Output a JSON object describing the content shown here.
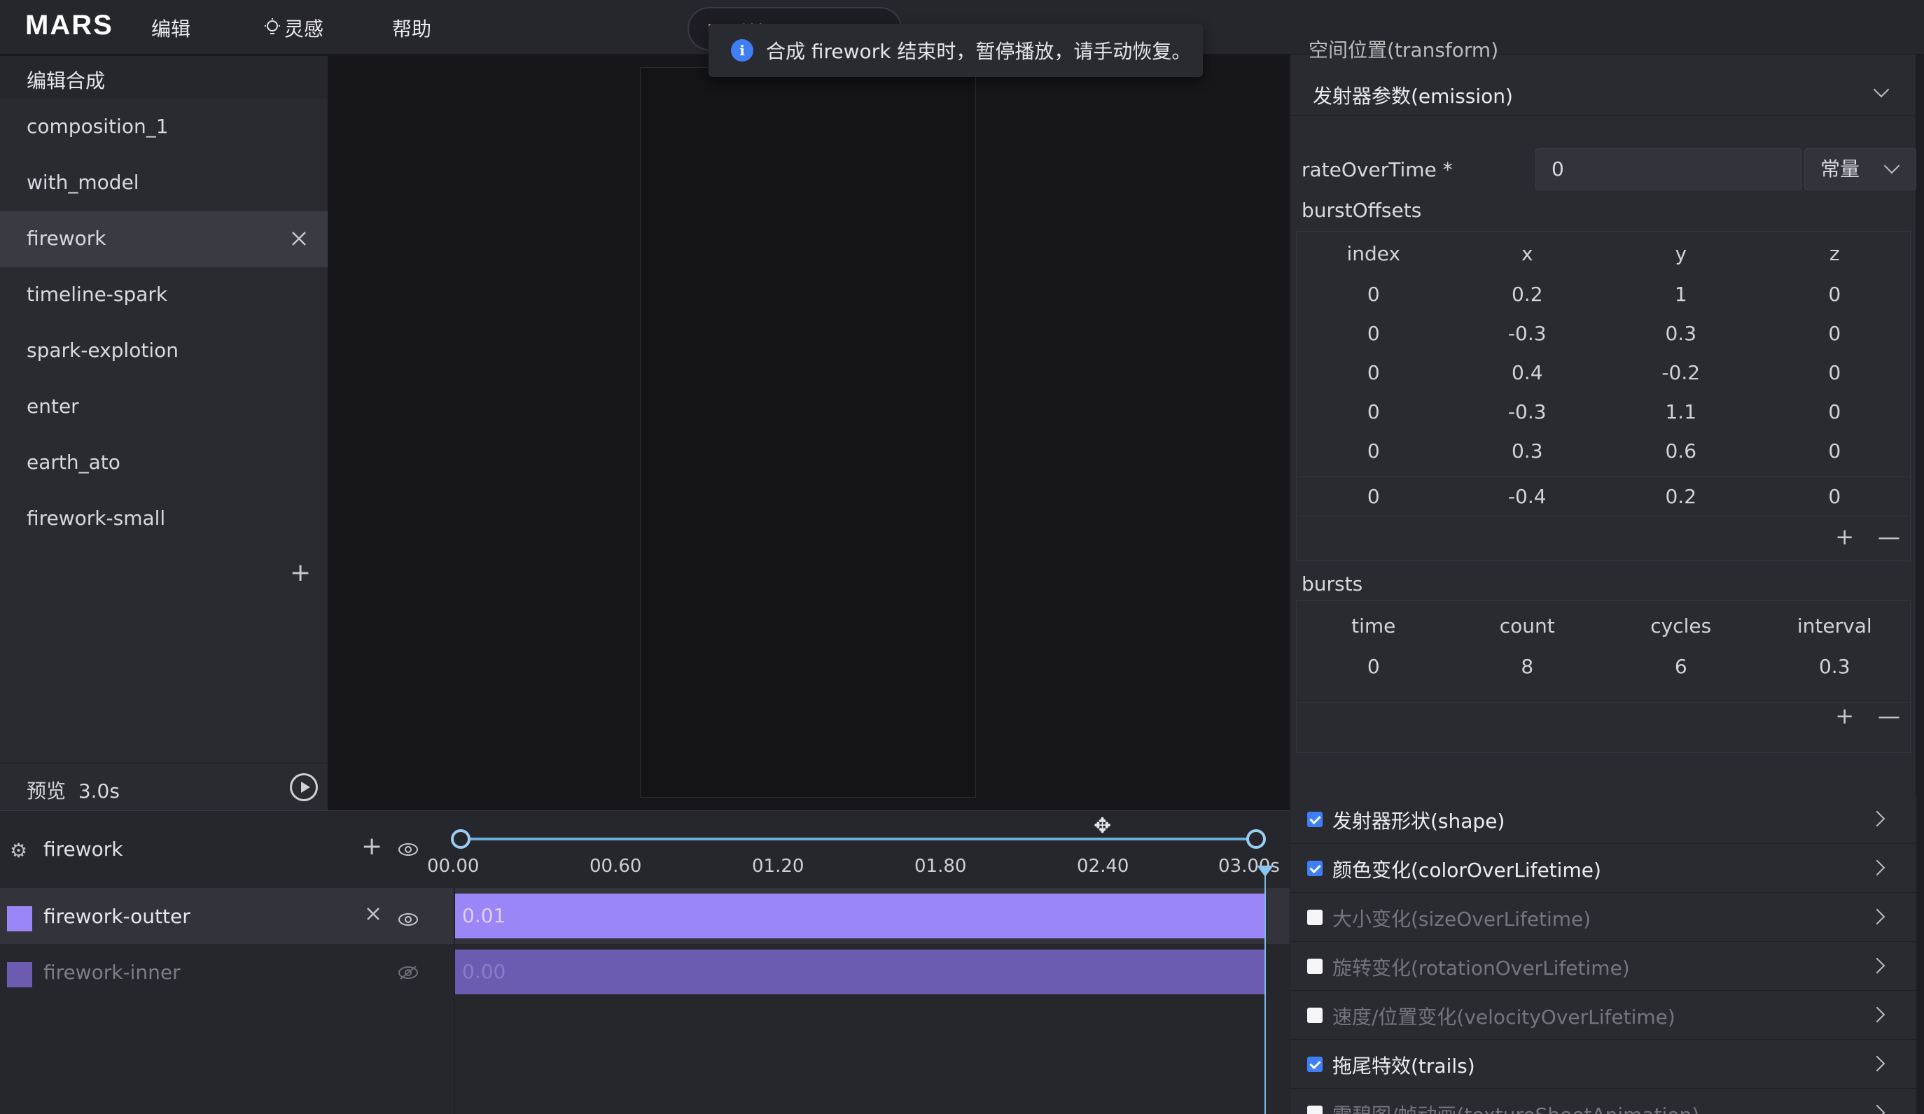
{
  "app": {
    "logo": "MARS"
  },
  "menu": {
    "edit": "编辑",
    "inspiration": "灵感",
    "inspiration_icon": "bulb-icon",
    "help": "帮助",
    "partial_pill_text": "回到首页 (ctrl+"
  },
  "toast": {
    "icon": "info-icon",
    "message": "合成 firework 结束时，暂停播放，请手动恢复。"
  },
  "left": {
    "header": "编辑合成",
    "compositions": [
      "composition_1",
      "with_model",
      "firework",
      "timeline-spark",
      "spark-explotion",
      "enter",
      "earth_ato",
      "firework-small"
    ],
    "active": "firework",
    "add": "+",
    "preview_label": "预览",
    "preview_duration": "3.0s"
  },
  "timeline": {
    "title": "firework",
    "add": "+",
    "ticks": [
      "00.00",
      "00.60",
      "01.20",
      "01.80",
      "02.40",
      "03.00s"
    ],
    "tracks": [
      {
        "name": "firework-outter",
        "value": "0.01",
        "color": "#9b85f7"
      },
      {
        "name": "firework-inner",
        "value": "0.00",
        "color": "#6c5bb0"
      }
    ]
  },
  "right": {
    "top_partial": "空间位置(transform)",
    "emission": {
      "title": "发射器参数(emission)",
      "rate_label": "rateOverTime *",
      "rate_value": "0",
      "rate_mode": "常量",
      "burst_offsets_label": "burstOffsets",
      "burst_offsets_headers": [
        "index",
        "x",
        "y",
        "z"
      ],
      "burst_offsets_rows": [
        [
          "0",
          "0.2",
          "1",
          "0"
        ],
        [
          "0",
          "-0.3",
          "0.3",
          "0"
        ],
        [
          "0",
          "0.4",
          "-0.2",
          "0"
        ],
        [
          "0",
          "-0.3",
          "1.1",
          "0"
        ],
        [
          "0",
          "0.3",
          "0.6",
          "0"
        ],
        [
          "0",
          "-0.4",
          "0.2",
          "0"
        ]
      ],
      "bursts_label": "bursts",
      "bursts_headers": [
        "time",
        "count",
        "cycles",
        "interval"
      ],
      "bursts_rows": [
        [
          "0",
          "8",
          "6",
          "0.3"
        ]
      ],
      "add": "+",
      "remove": "—"
    },
    "modules": [
      {
        "label": "发射器形状(shape)",
        "enabled": true
      },
      {
        "label": "颜色变化(colorOverLifetime)",
        "enabled": true
      },
      {
        "label": "大小变化(sizeOverLifetime)",
        "enabled": false
      },
      {
        "label": "旋转变化(rotationOverLifetime)",
        "enabled": false
      },
      {
        "label": "速度/位置变化(velocityOverLifetime)",
        "enabled": false
      },
      {
        "label": "拖尾特效(trails)",
        "enabled": true
      },
      {
        "label": "雪碧图/帧动画(textureSheetAnimation)",
        "enabled": false
      }
    ]
  }
}
